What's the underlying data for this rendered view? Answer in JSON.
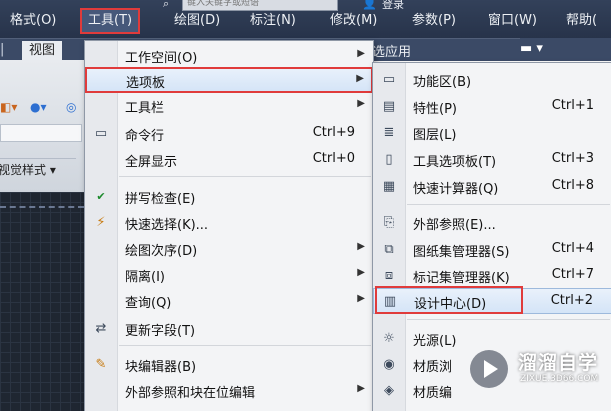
{
  "menubar": {
    "search_placeholder": "键入关键字或短语",
    "login": "登录",
    "items": [
      {
        "label": "格式(O)"
      },
      {
        "label": "工具(T)"
      },
      {
        "label": "绘图(D)"
      },
      {
        "label": "标注(N)"
      },
      {
        "label": "修改(M)"
      },
      {
        "label": "参数(P)"
      },
      {
        "label": "窗口(W)"
      },
      {
        "label": "帮助("
      }
    ]
  },
  "ribbon": {
    "tab_view": "视图",
    "tab_featured": "选应用",
    "visual_style": "视觉样式 ▾"
  },
  "tools_menu": {
    "items": [
      {
        "label": "工作空间(O)",
        "shortcut": "",
        "submenu": true,
        "icon": ""
      },
      {
        "label": "选项板",
        "shortcut": "",
        "submenu": true,
        "icon": ""
      },
      {
        "label": "工具栏",
        "shortcut": "",
        "submenu": true,
        "icon": ""
      },
      {
        "label": "命令行",
        "shortcut": "Ctrl+9",
        "submenu": false,
        "icon": "command-line-icon"
      },
      {
        "label": "全屏显示",
        "shortcut": "Ctrl+0",
        "submenu": false,
        "icon": ""
      },
      {
        "label": "拼写检查(E)",
        "shortcut": "",
        "submenu": false,
        "icon": "spell-check-icon"
      },
      {
        "label": "快速选择(K)...",
        "shortcut": "",
        "submenu": false,
        "icon": "quick-select-icon"
      },
      {
        "label": "绘图次序(D)",
        "shortcut": "",
        "submenu": true,
        "icon": ""
      },
      {
        "label": "隔离(I)",
        "shortcut": "",
        "submenu": true,
        "icon": ""
      },
      {
        "label": "查询(Q)",
        "shortcut": "",
        "submenu": true,
        "icon": ""
      },
      {
        "label": "更新字段(T)",
        "shortcut": "",
        "submenu": false,
        "icon": "update-field-icon"
      },
      {
        "label": "块编辑器(B)",
        "shortcut": "",
        "submenu": false,
        "icon": "block-editor-icon"
      },
      {
        "label": "外部参照和块在位编辑",
        "shortcut": "",
        "submenu": true,
        "icon": ""
      }
    ]
  },
  "palettes_menu": {
    "items": [
      {
        "label": "功能区(B)",
        "shortcut": "",
        "icon": "ribbon-icon"
      },
      {
        "label": "特性(P)",
        "shortcut": "Ctrl+1",
        "icon": "properties-icon"
      },
      {
        "label": "图层(L)",
        "shortcut": "",
        "icon": "layers-icon"
      },
      {
        "label": "工具选项板(T)",
        "shortcut": "Ctrl+3",
        "icon": "tool-palettes-icon"
      },
      {
        "label": "快速计算器(Q)",
        "shortcut": "Ctrl+8",
        "icon": "calculator-icon"
      },
      {
        "label": "外部参照(E)...",
        "shortcut": "",
        "icon": "xref-icon"
      },
      {
        "label": "图纸集管理器(S)",
        "shortcut": "Ctrl+4",
        "icon": "sheet-set-icon"
      },
      {
        "label": "标记集管理器(K)",
        "shortcut": "Ctrl+7",
        "icon": "markup-set-icon"
      },
      {
        "label": "设计中心(D)",
        "shortcut": "Ctrl+2",
        "icon": "design-center-icon"
      },
      {
        "label": "光源(L)",
        "shortcut": "",
        "icon": "lights-icon"
      },
      {
        "label": "材质浏",
        "shortcut": "",
        "icon": "materials-browser-icon"
      },
      {
        "label": "材质编",
        "shortcut": "",
        "icon": "materials-editor-icon"
      }
    ]
  },
  "watermark": {
    "brand": "溜溜自学",
    "url": "ZIXUE.3D66.COM"
  },
  "colors": {
    "highlight_box": "#e03b3b",
    "menubar_bg": "#2f3c54"
  }
}
